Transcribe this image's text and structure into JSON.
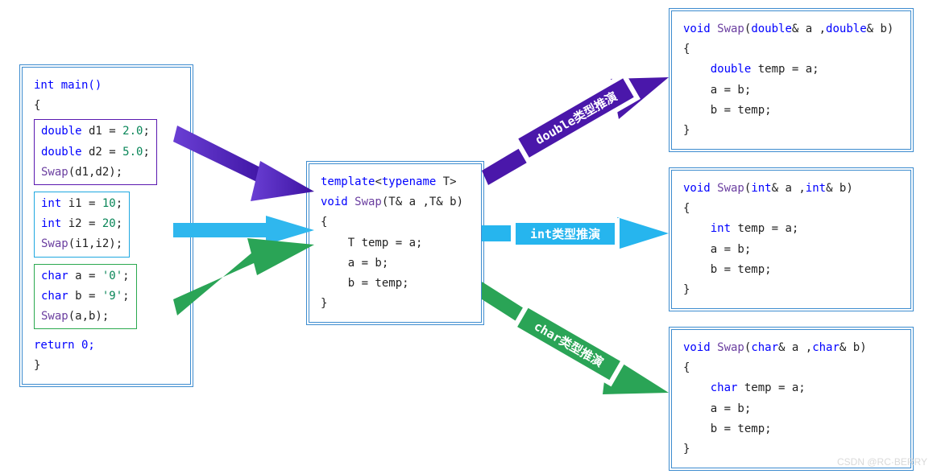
{
  "main_box": {
    "open": "int main()",
    "lbrace": "{",
    "double_block": {
      "l1_a": "double",
      "l1_b": " d1 ",
      "l1_c": "= ",
      "l1_d": "2.0",
      "l1_e": ";",
      "l2_a": "double",
      "l2_b": " d2 ",
      "l2_c": "= ",
      "l2_d": "5.0",
      "l2_e": ";",
      "l3_a": "Swap",
      "l3_b": "(d1,d2);"
    },
    "int_block": {
      "l1_a": "int",
      "l1_b": " i1 ",
      "l1_c": "= ",
      "l1_d": "10",
      "l1_e": ";",
      "l2_a": "int",
      "l2_b": " i2 ",
      "l2_c": "= ",
      "l2_d": "20",
      "l2_e": ";",
      "l3_a": "Swap",
      "l3_b": "(i1,i2);"
    },
    "char_block": {
      "l1_a": "char",
      "l1_b": " a ",
      "l1_c": "= ",
      "l1_d": "'0'",
      "l1_e": ";",
      "l2_a": "char",
      "l2_b": " b ",
      "l2_c": "= ",
      "l2_d": "'9'",
      "l2_e": ";",
      "l3_a": "Swap",
      "l3_b": "(a,b);"
    },
    "ret": "return 0;",
    "rbrace": "}"
  },
  "template_box": {
    "l1_a": "template",
    "l1_b": "<",
    "l1_c": "typename",
    "l1_d": " T>",
    "l2_a": "void",
    "l2_b": " Swap",
    "l2_c": "(T& a ,T& b)",
    "l3": "{",
    "l4": "    T temp = a;",
    "l5": "    a = b;",
    "l6": "    b = temp;",
    "l7": "}"
  },
  "out_double": {
    "l1_a": "void",
    "l1_b": " Swap",
    "l1_c": "(",
    "l1_d": "double",
    "l1_e": "& a ,",
    "l1_f": "double",
    "l1_g": "& b)",
    "l2": "{",
    "l3_a": "    ",
    "l3_b": "double",
    "l3_c": " temp = a;",
    "l4": "    a = b;",
    "l5": "    b = temp;",
    "l6": "}"
  },
  "out_int": {
    "l1_a": "void",
    "l1_b": " Swap",
    "l1_c": "(",
    "l1_d": "int",
    "l1_e": "& a ,",
    "l1_f": "int",
    "l1_g": "& b)",
    "l2": "{",
    "l3_a": "    ",
    "l3_b": "int",
    "l3_c": " temp = a;",
    "l4": "    a = b;",
    "l5": "    b = temp;",
    "l6": "}"
  },
  "out_char": {
    "l1_a": "void",
    "l1_b": " Swap",
    "l1_c": "(",
    "l1_d": "char",
    "l1_e": "& a ,",
    "l1_f": "char",
    "l1_g": "& b)",
    "l2": "{",
    "l3_a": "    ",
    "l3_b": "char",
    "l3_c": " temp = a;",
    "l4": "    a = b;",
    "l5": "    b = temp;",
    "l6": "}"
  },
  "labels": {
    "double": "double类型推演",
    "int": "int类型推演",
    "char": "char类型推演"
  },
  "watermark": "CSDN @RC·BERRY"
}
